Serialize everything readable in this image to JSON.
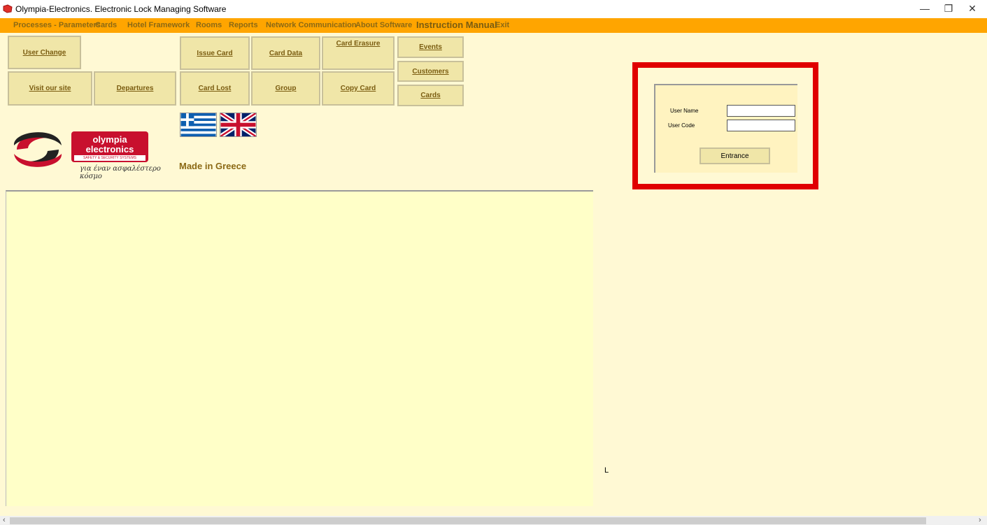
{
  "window": {
    "title": "Olympia-Electronics. Electronic Lock Managing Software",
    "minimize_glyph": "—",
    "restore_glyph": "❐",
    "close_glyph": "✕"
  },
  "menu": [
    {
      "label": "Processes - Parameters"
    },
    {
      "label": "Cards"
    },
    {
      "label": "Hotel Framework"
    },
    {
      "label": "Rooms"
    },
    {
      "label": "Reports"
    },
    {
      "label": "Network Communication"
    },
    {
      "label": "About Software"
    },
    {
      "label": "Instruction Manual"
    },
    {
      "label": "Exit"
    }
  ],
  "tiles": {
    "user_change": "User Change",
    "visit_site": "Visit our site",
    "departures": "Departures",
    "issue_card": "Issue Card",
    "card_data": "Card Data",
    "card_erasure": "Card Erasure",
    "events": "Events",
    "customers": "Customers",
    "cards": "Cards",
    "card_lost": "Card Lost",
    "group": "Group",
    "copy_card": "Copy Card"
  },
  "logo": {
    "brand_line1": "olympia",
    "brand_line2": "electronics",
    "tagline": "SAFETY & SECURITY SYSTEMS",
    "greek_slogan": "για έναν ασφαλέστερο κόσμο"
  },
  "made_in": "Made in Greece",
  "status_letter": "L",
  "login": {
    "username_label": "User Name",
    "usercode_label": "User Code",
    "username_value": "",
    "usercode_value": "",
    "entrance_label": "Entrance"
  },
  "scrollbar": {
    "left_arrow": "‹",
    "right_arrow": "›"
  },
  "colors": {
    "menubar": "#ffa500",
    "background": "#fff9d4",
    "highlight_frame": "#e00000",
    "tile": "#f0e6a8"
  }
}
